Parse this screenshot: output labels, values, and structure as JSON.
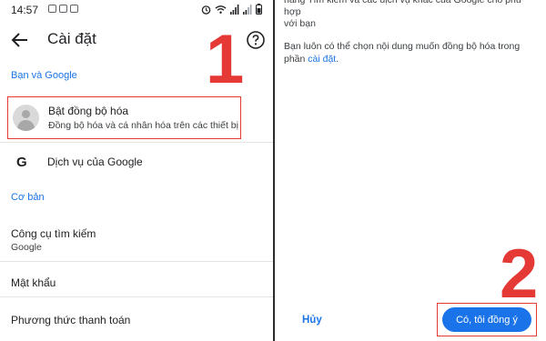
{
  "status_bar": {
    "time": "14:57"
  },
  "settings": {
    "title": "Cài đặt",
    "section_account": "Bạn và Google",
    "sync": {
      "title": "Bật đồng bộ hóa",
      "subtitle": "Đồng bộ hóa và cá nhân hóa trên các thiết bị"
    },
    "google_services": "Dịch vụ của Google",
    "section_basic": "Cơ bản",
    "search_engine": {
      "label": "Công cụ tìm kiếm",
      "value": "Google"
    },
    "passwords": "Mật khẩu",
    "payment_methods": "Phương thức thanh toán"
  },
  "step_numbers": {
    "one": "1",
    "two": "2"
  },
  "sync_dialog": {
    "top_text_line1": "năng Tìm kiếm và các dịch vụ khác của Google cho phù hợp",
    "top_text_line2": "với bạn",
    "info_text": "Bạn luôn có thể chọn nội dung muốn đồng bộ hóa trong phần",
    "info_link": "cài đặt",
    "info_end": ".",
    "cancel_label": "Hủy",
    "agree_label": "Có, tôi đồng ý"
  },
  "colors": {
    "accent": "#1a73e8",
    "highlight_red": "#e53935"
  },
  "icons": [
    "back-arrow-icon",
    "help-icon",
    "google-g-icon",
    "avatar-icon",
    "alarm-icon",
    "wifi-icon",
    "signal-icon",
    "battery-icon"
  ]
}
